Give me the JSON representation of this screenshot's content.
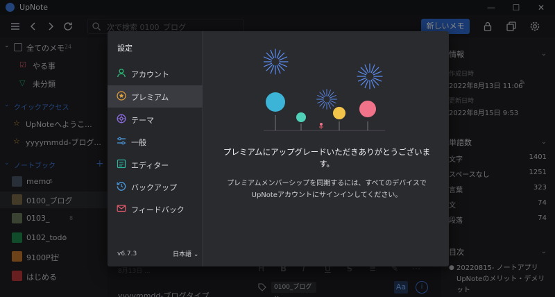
{
  "app": {
    "title": "UpNote"
  },
  "toolbar": {
    "search_placeholder": "次で検索 0100_ブログ",
    "new_note_label": "新しいメモ"
  },
  "sidebar": {
    "all_notes": {
      "label": "全てのメモ",
      "count": "24"
    },
    "todo": {
      "label": "やる事"
    },
    "uncategorized": {
      "label": "未分類"
    },
    "quick_access_header": "クイックアクセス",
    "quick_access": [
      {
        "label": "UpNoteへようこ..."
      },
      {
        "label": "yyyymmdd-ブログ..."
      }
    ],
    "notebooks_header": "ノートブック",
    "notebooks": [
      {
        "label": "memo",
        "count": "5",
        "color": "#4a5668"
      },
      {
        "label": "0100_ブログ",
        "count": "5",
        "color": "#7a6a4a"
      },
      {
        "label": "0103_",
        "count": "8",
        "color": "#6b7a5a"
      },
      {
        "label": "0102_todo",
        "count": "1",
        "color": "#1e8a4e"
      },
      {
        "label": "9100P社",
        "count": "2",
        "color": "#c9782c"
      },
      {
        "label": "はじめる",
        "count": "",
        "color": "#c0393b"
      }
    ]
  },
  "notelist": {
    "date_partial": "8月13日 ...",
    "title_partial": "yyyymmdd-ブログタイプ"
  },
  "editor": {
    "tag": "0100_ブログ ×",
    "aa_label": "Aa",
    "info_label": "i",
    "format_icons": [
      "H",
      "B",
      "I",
      "U",
      "S",
      "≡",
      "A",
      "✎",
      "⋯"
    ]
  },
  "right_panel": {
    "info_header": "情報",
    "created_label": "作成日時",
    "created_value": "2022年8月13日 11:06",
    "updated_label": "更新日時",
    "updated_value": "2022年8月15日 9:53",
    "wordcount_header": "単語数",
    "stats": [
      {
        "label": "文字",
        "value": "1401"
      },
      {
        "label": "スペースなし",
        "value": "1251"
      },
      {
        "label": "言葉",
        "value": "323"
      },
      {
        "label": "文",
        "value": "74"
      },
      {
        "label": "段落",
        "value": "74"
      }
    ],
    "toc_header": "目次",
    "toc_item": "20220815- ノートアプリ UpNoteのメリット・デメリット"
  },
  "modal": {
    "heading": "設定",
    "nav": [
      {
        "label": "アカウント",
        "icon": "account-icon",
        "color": "#2bb673"
      },
      {
        "label": "プレミアム",
        "icon": "premium-star-icon",
        "color": "#e2a23b"
      },
      {
        "label": "テーマ",
        "icon": "theme-palette-icon",
        "color": "#8a6bdc"
      },
      {
        "label": "一般",
        "icon": "general-sliders-icon",
        "color": "#4a9be0"
      },
      {
        "label": "エディター",
        "icon": "editor-icon",
        "color": "#2bb6a0"
      },
      {
        "label": "バックアップ",
        "icon": "backup-icon",
        "color": "#4a9be0"
      },
      {
        "label": "フィードバック",
        "icon": "feedback-mail-icon",
        "color": "#e05a6a"
      }
    ],
    "version": "v6.7.3",
    "language": "日本語 ⌄",
    "message_title": "プレミアムにアップグレードいただきありがとうございます。",
    "message_body": "プレミアムメンバーシップを同期するには、すべてのデバイスでUpNoteアカウントにサインインしてください。"
  },
  "colors": {
    "accent": "#2f6bd2",
    "background": "#1c1d21",
    "modal": "#2a2b2f",
    "balloon_blue": "#3bb4d8",
    "balloon_teal": "#4fd1b8",
    "balloon_yellow": "#f2c54a",
    "balloon_pink": "#f0738a"
  }
}
